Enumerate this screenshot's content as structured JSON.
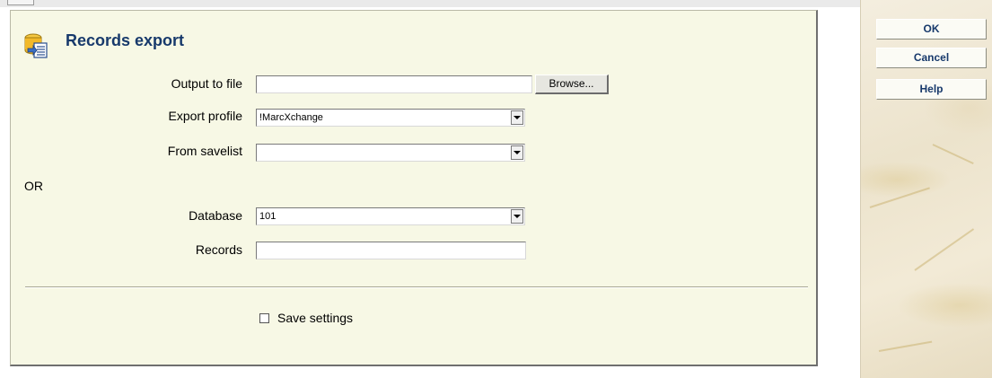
{
  "dialog": {
    "title": "Records export",
    "fields": {
      "output_to_file": {
        "label": "Output to file",
        "value": ""
      },
      "browse_label": "Browse...",
      "export_profile": {
        "label": "Export profile",
        "value": "!MarcXchange"
      },
      "from_savelist": {
        "label": "From savelist",
        "value": ""
      },
      "or_label": "OR",
      "database": {
        "label": "Database",
        "value": "101"
      },
      "records": {
        "label": "Records",
        "value": ""
      }
    },
    "save_settings": {
      "label": "Save settings",
      "checked": false
    }
  },
  "sidebar": {
    "buttons": [
      "OK",
      "Cancel",
      "Help"
    ]
  },
  "colors": {
    "title": "#17396b",
    "panel_bg": "#f7f8e5",
    "button_text": "#17396b"
  },
  "icons": {
    "title_icon": "export-database-icon",
    "select_arrow": "chevron-down-icon"
  }
}
